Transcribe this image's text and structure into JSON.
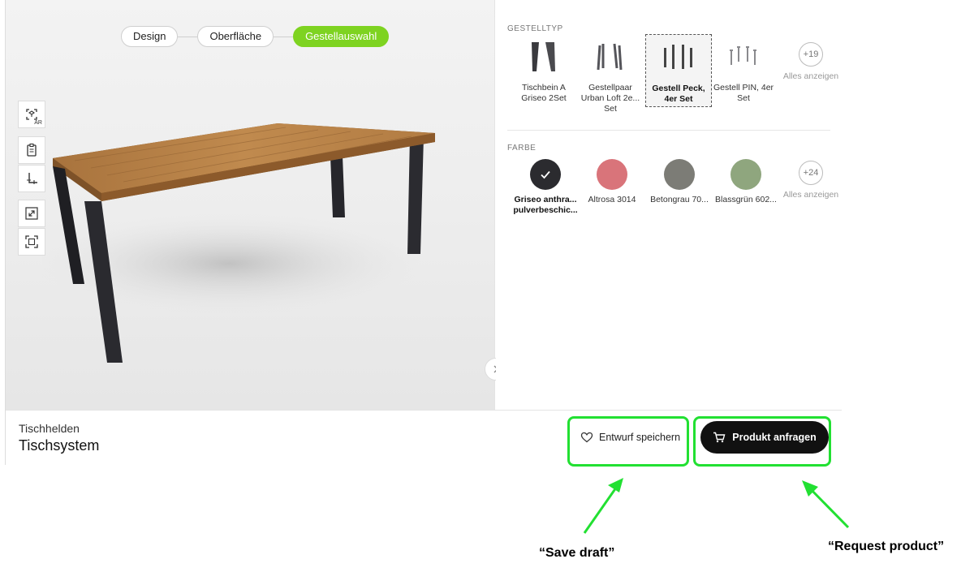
{
  "stepper": {
    "steps": [
      "Design",
      "Oberfläche",
      "Gestellauswahl"
    ],
    "active_index": 2
  },
  "toolbar": {
    "ar_label": "AR"
  },
  "frame_type": {
    "title": "GESTELLTYP",
    "options": [
      {
        "label": "Tischbein A Griseo 2Set",
        "selected": false
      },
      {
        "label": "Gestellpaar Urban Loft 2e... Set",
        "selected": false
      },
      {
        "label": "Gestell Peck, 4er Set",
        "selected": true
      },
      {
        "label": "Gestell PIN, 4er Set",
        "selected": false
      }
    ],
    "more": {
      "count": "+19",
      "label": "Alles anzeigen"
    }
  },
  "color": {
    "title": "FARBE",
    "options": [
      {
        "label": "Griseo anthra... pulverbeschic...",
        "hex": "#2b2b2f",
        "selected": true
      },
      {
        "label": "Altrosa 3014",
        "hex": "#d9747a",
        "selected": false
      },
      {
        "label": "Betongrau 70...",
        "hex": "#7c7c76",
        "selected": false
      },
      {
        "label": "Blassgrün 602...",
        "hex": "#8fa67e",
        "selected": false
      }
    ],
    "more": {
      "count": "+24",
      "label": "Alles anzeigen"
    }
  },
  "footer": {
    "brand": "Tischhelden",
    "product": "Tischsystem",
    "save_label": "Entwurf speichern",
    "request_label": "Produkt anfragen"
  },
  "annotations": {
    "save": "“Save draft”",
    "request": "“Request product”",
    "color": "#22e032"
  }
}
